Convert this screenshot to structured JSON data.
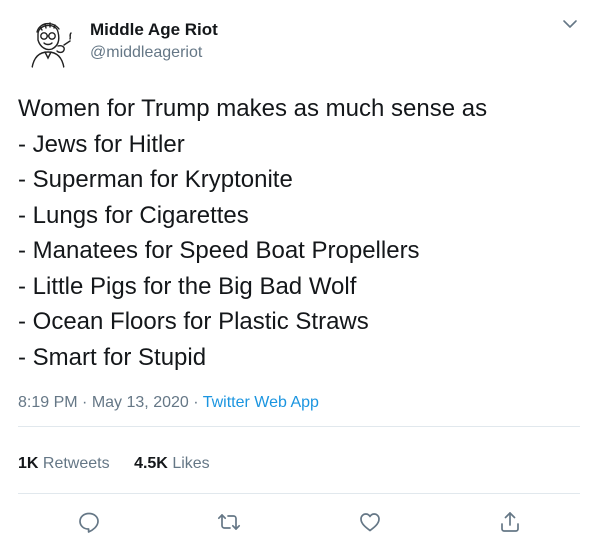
{
  "author": {
    "display_name": "Middle Age Riot",
    "handle": "@middleageriot",
    "avatar_icon": "sketch-portrait-avatar"
  },
  "tweet": {
    "lines": [
      "Women for Trump makes as much sense as",
      "- Jews for Hitler",
      "- Superman for Kryptonite",
      "- Lungs for Cigarettes",
      "- Manatees for Speed Boat Propellers",
      "- Little Pigs for the Big Bad Wolf",
      "- Ocean Floors for Plastic Straws",
      "- Smart for Stupid"
    ]
  },
  "meta": {
    "time": "8:19 PM",
    "separator": "·",
    "date": "May 13, 2020",
    "source": "Twitter Web App"
  },
  "stats": {
    "retweets_count": "1K",
    "retweets_label": "Retweets",
    "likes_count": "4.5K",
    "likes_label": "Likes"
  },
  "actions": {
    "icons": [
      "reply-icon",
      "retweet-icon",
      "like-icon",
      "share-icon"
    ]
  },
  "colors": {
    "text": "#14171a",
    "secondary": "#657786",
    "link": "#1b95e0",
    "divider": "#e1e8ed"
  }
}
